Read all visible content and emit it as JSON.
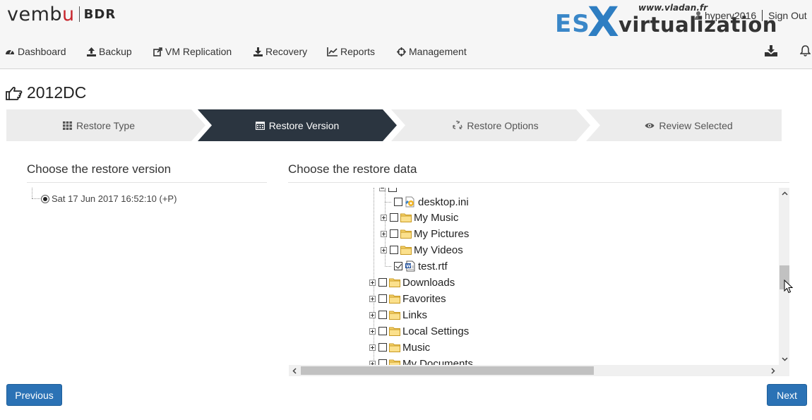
{
  "app": {
    "brand": "vembu",
    "product": "BDR"
  },
  "watermark": {
    "url": "www.vladan.fr",
    "es": "ES",
    "x": "X",
    "virtualization": "virtualization"
  },
  "user": {
    "name": "hyperv2016",
    "sign_out": "Sign Out"
  },
  "nav": {
    "items": [
      {
        "label": "Dashboard",
        "icon": "dashboard-icon"
      },
      {
        "label": "Backup",
        "icon": "upload-icon"
      },
      {
        "label": "VM Replication",
        "icon": "external-link-icon"
      },
      {
        "label": "Recovery",
        "icon": "download-icon"
      },
      {
        "label": "Reports",
        "icon": "line-chart-icon"
      },
      {
        "label": "Management",
        "icon": "crosshairs-icon"
      }
    ],
    "right_icons": [
      "download-tray-icon",
      "bell-icon"
    ]
  },
  "page": {
    "title": "2012DC",
    "title_icon": "hand-pointing-icon"
  },
  "wizard": {
    "steps": [
      {
        "label": "Restore Type",
        "icon": "grid-icon",
        "active": false
      },
      {
        "label": "Restore Version",
        "icon": "calendar-icon",
        "active": true
      },
      {
        "label": "Restore Options",
        "icon": "recycle-icon",
        "active": false
      },
      {
        "label": "Review Selected",
        "icon": "eye-icon",
        "active": false
      }
    ],
    "colors": {
      "active": "#2b3540",
      "inactive": "#ececec"
    }
  },
  "version_panel": {
    "heading": "Choose the restore version",
    "versions": [
      {
        "label": "Sat 17 Jun 2017 16:52:10 (+P)",
        "selected": true
      }
    ]
  },
  "data_panel": {
    "heading": "Choose the restore data",
    "tree": [
      {
        "label": "desktop.ini",
        "type": "ini-file",
        "checked": false,
        "expandable": false
      },
      {
        "label": "My Music",
        "type": "folder",
        "checked": false,
        "expandable": true
      },
      {
        "label": "My Pictures",
        "type": "folder",
        "checked": false,
        "expandable": true
      },
      {
        "label": "My Videos",
        "type": "folder",
        "checked": false,
        "expandable": true
      },
      {
        "label": "test.rtf",
        "type": "rtf-file",
        "checked": true,
        "expandable": false
      },
      {
        "label": "Downloads",
        "type": "folder",
        "checked": false,
        "expandable": true
      },
      {
        "label": "Favorites",
        "type": "folder",
        "checked": false,
        "expandable": true
      },
      {
        "label": "Links",
        "type": "folder",
        "checked": false,
        "expandable": true
      },
      {
        "label": "Local Settings",
        "type": "folder",
        "checked": false,
        "expandable": true
      },
      {
        "label": "Music",
        "type": "folder",
        "checked": false,
        "expandable": true
      },
      {
        "label": "My Documents",
        "type": "folder",
        "checked": false,
        "expandable": true
      }
    ]
  },
  "buttons": {
    "previous": "Previous",
    "next": "Next"
  },
  "colors": {
    "primary_button": "#2b72b5",
    "brand_red": "#c7262d",
    "watermark_blue": "#2e7ec2"
  }
}
